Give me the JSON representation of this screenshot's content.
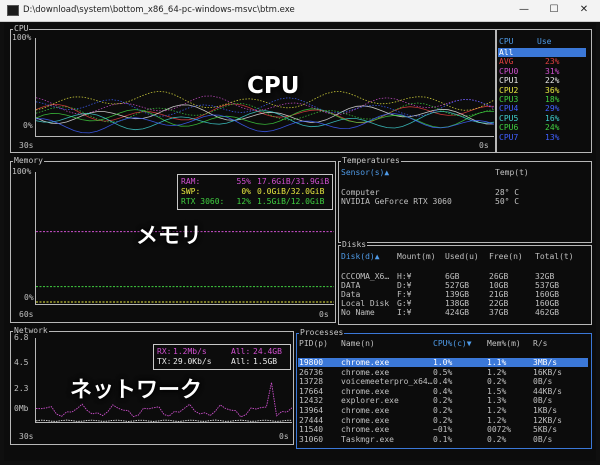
{
  "window": {
    "title": "D:\\download\\system\\bottom_x86_64-pc-windows-msvc\\btm.exe",
    "min": "—",
    "max": "☐",
    "close": "✕"
  },
  "overlays": {
    "cpu": "CPU",
    "memory": "メモリ",
    "network": "ネットワーク"
  },
  "cpu": {
    "title": "CPU",
    "y_top": "100%",
    "y_bottom": "0%",
    "x_left": "30s",
    "x_right": "0s",
    "legend_header": {
      "name": "CPU",
      "use": "Use"
    },
    "legend": [
      {
        "name": "All",
        "use": "",
        "color": "#ffffff",
        "selected": true
      },
      {
        "name": "AVG",
        "use": "23%",
        "color": "#e04040"
      },
      {
        "name": "CPU0",
        "use": "31%",
        "color": "#d050d0"
      },
      {
        "name": "CPU1",
        "use": "22%",
        "color": "#e8e8e8"
      },
      {
        "name": "CPU2",
        "use": "36%",
        "color": "#e8e840"
      },
      {
        "name": "CPU3",
        "use": "18%",
        "color": "#40d040"
      },
      {
        "name": "CPU4",
        "use": "29%",
        "color": "#4060ff"
      },
      {
        "name": "CPU5",
        "use": "16%",
        "color": "#40d0d0"
      },
      {
        "name": "CPU6",
        "use": "24%",
        "color": "#40d040"
      },
      {
        "name": "CPU7",
        "use": "13%",
        "color": "#4060ff"
      }
    ]
  },
  "memory": {
    "title": "Memory",
    "y_top": "100%",
    "y_bottom": "0%",
    "x_left": "60s",
    "x_right": "0s",
    "legend": [
      {
        "label": "RAM:",
        "pct": "55%",
        "amount": "17.6GiB/31.9GiB",
        "color": "#d050d0"
      },
      {
        "label": "SWP:",
        "pct": "0%",
        "amount": "0.0GiB/32.0GiB",
        "color": "#e8e840"
      },
      {
        "label": "RTX 3060:",
        "pct": "12%",
        "amount": "1.5GiB/12.0GiB",
        "color": "#40d040"
      }
    ],
    "chart_data": {
      "type": "line",
      "ylim": [
        0,
        100
      ],
      "series": [
        {
          "name": "RAM",
          "values": [
            55,
            55,
            55,
            55,
            55,
            55,
            55,
            55,
            55,
            55,
            55,
            55
          ]
        },
        {
          "name": "SWP",
          "values": [
            0,
            0,
            0,
            0,
            0,
            0,
            0,
            0,
            0,
            0,
            0,
            0
          ]
        },
        {
          "name": "RTX 3060",
          "values": [
            12,
            12,
            12,
            12,
            12,
            12,
            12,
            12,
            12,
            12,
            12,
            12
          ]
        }
      ]
    }
  },
  "temps": {
    "title": "Temperatures",
    "col1": "Sensor(s)▲",
    "col2": "Temp(t)",
    "rows": [
      {
        "sensor": "Computer",
        "temp": "28° C"
      },
      {
        "sensor": "NVIDIA GeForce RTX 3060",
        "temp": "50° C"
      }
    ]
  },
  "disks": {
    "title": "Disks",
    "cols": [
      "Disk(d)▲",
      "Mount(m)",
      "Used(u)",
      "Free(n)",
      "Total(t)"
    ],
    "rows": [
      [
        "CCCOMA_X6…",
        "H:¥",
        "6GB",
        "26GB",
        "32GB"
      ],
      [
        "DATA",
        "D:¥",
        "527GB",
        "10GB",
        "537GB"
      ],
      [
        "Data",
        "F:¥",
        "139GB",
        "21GB",
        "160GB"
      ],
      [
        "Local Disk",
        "G:¥",
        "138GB",
        "22GB",
        "160GB"
      ],
      [
        "No Name",
        "I:¥",
        "424GB",
        "37GB",
        "462GB"
      ]
    ]
  },
  "network": {
    "title": "Network",
    "y_ticks": [
      "6.8",
      "4.5",
      "2.3",
      "0Mb"
    ],
    "x_left": "30s",
    "x_right": "0s",
    "legend": [
      {
        "label": "RX:",
        "rate": "1.2Mb/s",
        "all_label": "All:",
        "all": "24.4GB",
        "color": "#d050d0"
      },
      {
        "label": "TX:",
        "rate": "29.0Kb/s",
        "all_label": "All:",
        "all": "1.5GB",
        "color": "#e8e8e8"
      }
    ]
  },
  "processes": {
    "title": "Processes",
    "cols": [
      "PID(p)",
      "Name(n)",
      "CPU%(c)▼",
      "Mem%(m)",
      "R/s"
    ],
    "rows": [
      [
        "19800",
        "chrome.exe",
        "1.0%",
        "1.1%",
        "3MB/s"
      ],
      [
        "26736",
        "chrome.exe",
        "0.5%",
        "1.2%",
        "16KB/s"
      ],
      [
        "13728",
        "voicemeeterpro_x64…",
        "0.4%",
        "0.2%",
        "0B/s"
      ],
      [
        "17664",
        "chrome.exe",
        "0.4%",
        "1.5%",
        "44KB/s"
      ],
      [
        "12432",
        "explorer.exe",
        "0.2%",
        "1.3%",
        "0B/s"
      ],
      [
        "13964",
        "chrome.exe",
        "0.2%",
        "1.2%",
        "1KB/s"
      ],
      [
        "27444",
        "chrome.exe",
        "0.2%",
        "1.2%",
        "12KB/s"
      ],
      [
        "11540",
        "chrome.exe",
        "~01%",
        "0072%",
        "5KB/s"
      ],
      [
        "31060",
        "Taskmgr.exe",
        "0.1%",
        "0.2%",
        "0B/s"
      ]
    ]
  }
}
